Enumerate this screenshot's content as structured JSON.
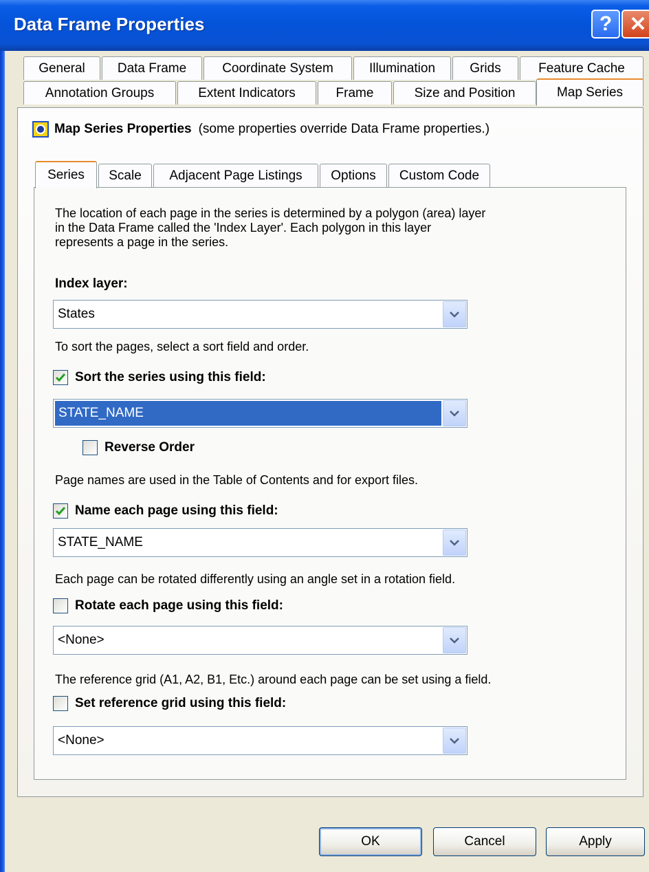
{
  "window": {
    "title": "Data Frame Properties",
    "help_label": "?",
    "close_label": "✕"
  },
  "tabs_row1": [
    "General",
    "Data Frame",
    "Coordinate System",
    "Illumination",
    "Grids",
    "Feature Cache"
  ],
  "tabs_row2": [
    "Annotation Groups",
    "Extent Indicators",
    "Frame",
    "Size and Position",
    "Map Series"
  ],
  "map_series": {
    "title": "Map Series Properties",
    "note": "(some properties override Data Frame properties.)"
  },
  "inner_tabs": [
    "Series",
    "Scale",
    "Adjacent Page Listings",
    "Options",
    "Custom Code"
  ],
  "series": {
    "description_lines": [
      "The location of each page in the series is determined by a polygon (area) layer",
      "in the Data Frame called the 'Index Layer'.  Each polygon in this layer",
      "represents a page in the series."
    ],
    "index_layer_label": "Index layer:",
    "index_layer_value": "States",
    "sort_hint": "To sort the pages, select a sort field and order.",
    "sort_checkbox_label": "Sort the series using this field:",
    "sort_checked": true,
    "sort_field_value": "STATE_NAME",
    "reverse_order_label": "Reverse Order",
    "reverse_checked": false,
    "page_names_hint": "Page names are used in the Table of Contents and for export files.",
    "name_checkbox_label": "Name each page using this field:",
    "name_checked": true,
    "name_field_value": "STATE_NAME",
    "rotate_hint": "Each page can be rotated differently using an angle set in a rotation field.",
    "rotate_checkbox_label": "Rotate each page using this field:",
    "rotate_checked": false,
    "rotate_field_value": "<None>",
    "grid_hint": "The reference grid (A1, A2, B1, Etc.) around each page can be set using a field.",
    "grid_checkbox_label": "Set reference grid using this field:",
    "grid_checked": false,
    "grid_field_value": "<None>"
  },
  "buttons": {
    "ok": "OK",
    "cancel": "Cancel",
    "apply": "Apply"
  },
  "colors": {
    "selection": "#316ac5",
    "active_tab_accent": "#e68b2c",
    "title_bar": "#0453d8",
    "check": "#21a121"
  }
}
